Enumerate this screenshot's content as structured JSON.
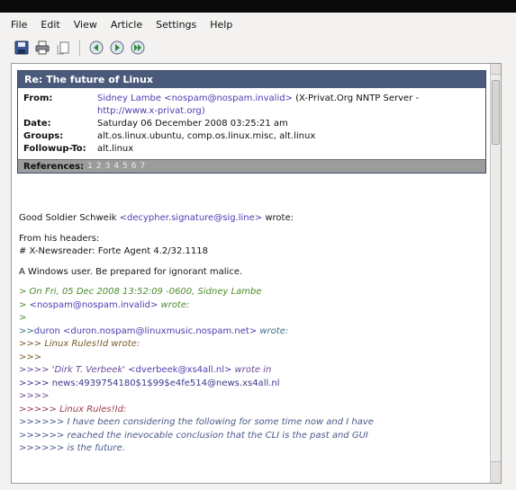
{
  "menu": [
    "File",
    "Edit",
    "View",
    "Article",
    "Settings",
    "Help"
  ],
  "toolbar": [
    {
      "icon": "save-icon"
    },
    {
      "icon": "print-icon"
    },
    {
      "icon": "copy-icon"
    },
    {
      "icon": "previous-article-icon"
    },
    {
      "icon": "next-article-icon"
    },
    {
      "icon": "next-unread-icon"
    }
  ],
  "header": {
    "subject": "Re: The future of Linux",
    "from_label": "From:",
    "from_name": "Sidney Lambe ",
    "from_addr": "<nospam@nospam.invalid>",
    "from_server": " (X-Privat.Org NNTP Server -",
    "from_url": "http://www.x-privat.org)",
    "date_label": "Date:",
    "date_value": "Saturday 06 December 2008 03:25:21 am",
    "groups_label": "Groups:",
    "groups_value": "alt.os.linux.ubuntu, comp.os.linux.misc, alt.linux",
    "followup_label": "Followup-To:",
    "followup_value": "alt.linux",
    "references_label": "References:",
    "references": [
      "1",
      "2",
      "3",
      "4",
      "5",
      "6",
      "7"
    ]
  },
  "body": {
    "l1a": "Good Soldier Schweik ",
    "l1b": "<decypher.signature@sig.line>",
    "l1c": " wrote:",
    "l2": "From his headers:",
    "l3": "# X-Newsreader: Forte Agent 4.2/32.1118",
    "l4": "A Windows user. Be prepared for ignorant malice.",
    "q1": "> On Fri, 05 Dec 2008 13:52:09 -0600, Sidney Lambe",
    "q2a": "> ",
    "q2b": "<nospam@nospam.invalid>",
    "q2c": " wrote:",
    "q3": ">",
    "q4a": ">>",
    "q4b": "duron <duron.nospam@linuxmusic.nospam.net>",
    "q4c": " wrote:",
    "q5": ">>> Linux Rules!Id wrote:",
    "q6": ">>>",
    "q7a": ">>>> 'Dirk T. Verbeek' ",
    "q7b": "<dverbeek@xs4all.nl>",
    "q7c": " wrote in",
    "q8": ">>>> news:4939754180$1$99$e4fe514@news.xs4all.nl",
    "q9": ">>>>",
    "q10": ">>>>> Linux Rules!Id:",
    "q11": ">>>>>> I have been considering the following for some time now and I have",
    "q12": ">>>>>> reached the inevocable conclusion that the CLI is the past and GUI",
    "q13": ">>>>>> is the future."
  }
}
